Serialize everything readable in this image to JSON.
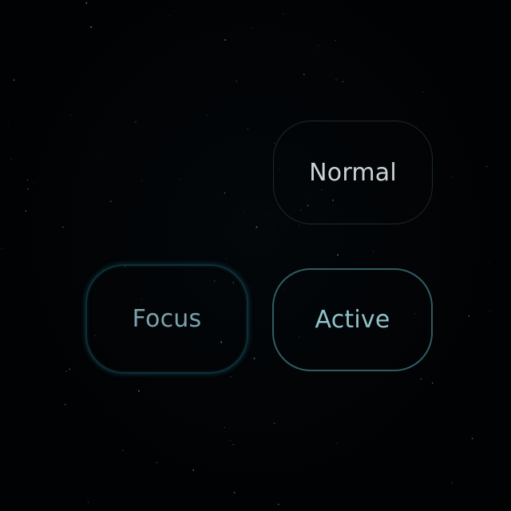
{
  "buttons": {
    "normal": {
      "label": "Normal"
    },
    "focus": {
      "label": "Focus"
    },
    "active": {
      "label": "Active"
    }
  },
  "colors": {
    "background": "#010203",
    "normal_border": "#1a2a2e",
    "normal_text": "#c9d2d5",
    "focus_border": "#0d3038",
    "focus_text": "#7aa3ad",
    "active_border": "#2f5d64",
    "active_text": "#8fc2c9"
  }
}
